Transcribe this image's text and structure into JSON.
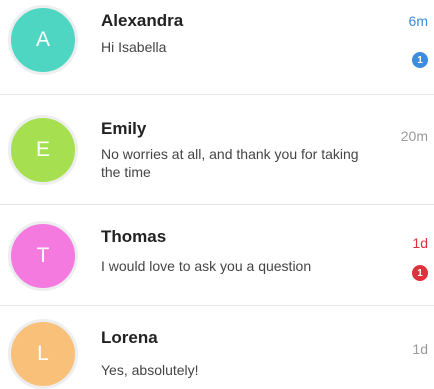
{
  "conversations": [
    {
      "initial": "A",
      "name": "Alexandra",
      "message": "Hi Isabella",
      "time": "6m",
      "unread": "1",
      "avatar_color": "#4fd6c3",
      "time_color": "#3a8de0",
      "badge_color": "#3a8de0"
    },
    {
      "initial": "E",
      "name": "Emily",
      "message": "No worries at all, and thank you for taking the time",
      "time": "20m",
      "avatar_color": "#a6e050"
    },
    {
      "initial": "T",
      "name": "Thomas",
      "message": "I would love to ask you a question",
      "time": "1d",
      "unread": "1",
      "avatar_color": "#f57ae0",
      "time_color": "#e0303a",
      "badge_color": "#e0303a"
    },
    {
      "initial": "L",
      "name": "Lorena",
      "message": "Yes, absolutely!",
      "time": "1d",
      "avatar_color": "#f9c07a"
    }
  ]
}
